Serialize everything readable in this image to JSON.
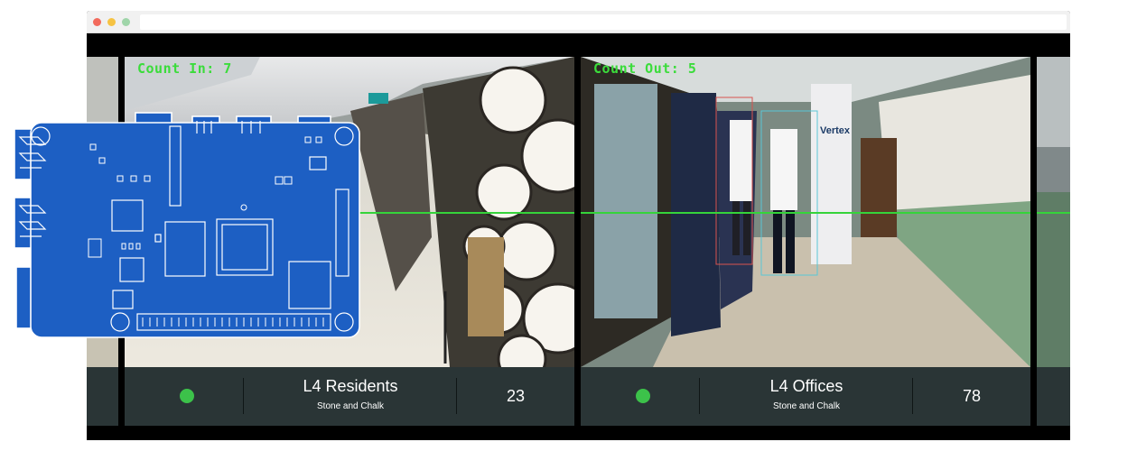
{
  "cameras": [
    {
      "overlay_top": "",
      "overlay_label": "Count In: 7",
      "name": "L4 Residents",
      "subtitle": "Stone and Chalk",
      "count": "23",
      "status": "online"
    },
    {
      "overlay_top": "",
      "overlay_label": "Count Out: 5",
      "name": "L4 Offices",
      "subtitle": "Stone and Chalk",
      "count": "78",
      "status": "online"
    }
  ],
  "signage": {
    "vertex_logo": "Vertex"
  },
  "colors": {
    "status_online": "#3cc24a",
    "overlay_text": "#3bdc3b",
    "footer_bg": "#2a3536",
    "board_blue": "#1d5fc3"
  },
  "icons": {
    "board": "raspberry-pi-board-icon"
  }
}
